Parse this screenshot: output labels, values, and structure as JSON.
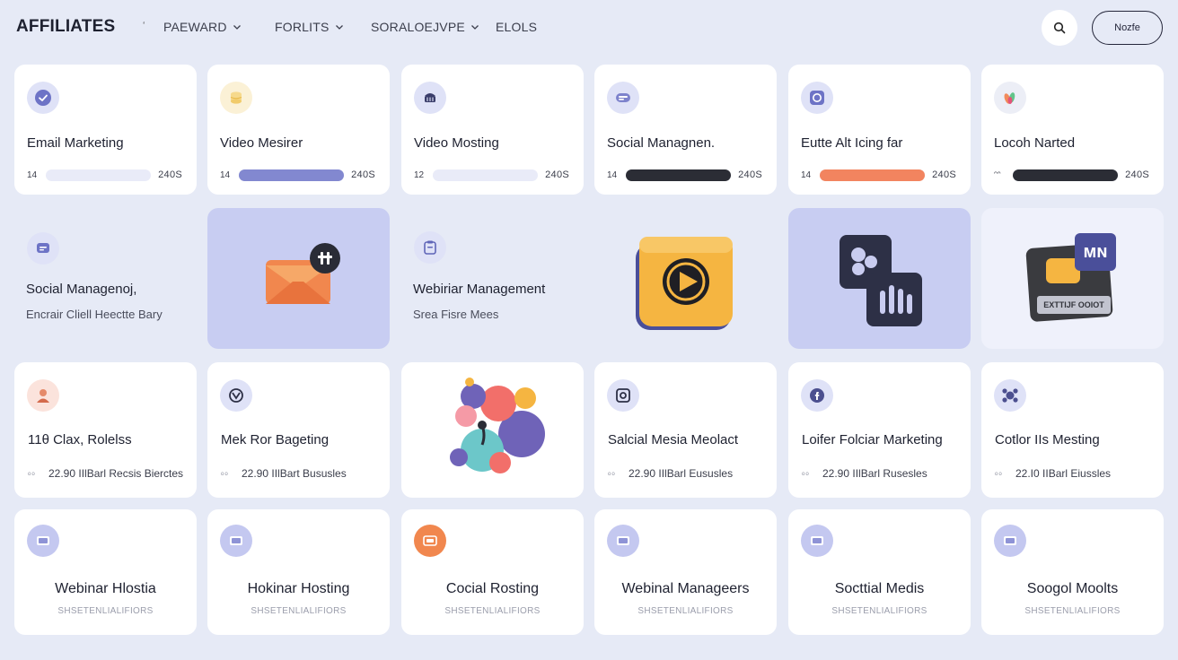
{
  "header": {
    "brand": "AFFILIATES",
    "nav_tick": "ʻ",
    "nav": [
      "PAEWARD",
      "FORLITS",
      "SORALOEJVPE",
      "ELOLS"
    ],
    "cta": "Nozfe"
  },
  "row1": [
    {
      "title": "Email Marketing",
      "left": "14",
      "right": "240S",
      "progress": 0,
      "color": "#e9ebf8"
    },
    {
      "title": "Video Mesirer",
      "left": "14",
      "right": "240S",
      "progress": 1.0,
      "color": "#8288d0"
    },
    {
      "title": "Video Mosting",
      "left": "12",
      "right": "240S",
      "progress": 0,
      "color": "#e9ebf8"
    },
    {
      "title": "Social Managnen.",
      "left": "14",
      "right": "240S",
      "progress": 1.0,
      "color": "#2b2d35"
    },
    {
      "title": "Eutte Alt Icing far",
      "left": "14",
      "right": "240S",
      "progress": 1.0,
      "color": "#f2845f"
    },
    {
      "title": "Locoh Narted",
      "left": "ᵔᵔ",
      "right": "240S",
      "progress": 1.0,
      "color": "#2b2d35"
    }
  ],
  "row2": [
    {
      "title": "Social Managenoj,",
      "sub": "Encrair Cliell Heectte Bary"
    },
    {
      "title": "Webiriar Management",
      "sub": "Srea Fisre Mees"
    }
  ],
  "row2_art": {
    "card6_label_top": "ᴍɴ",
    "card6_label_bottom": "EXTTIJF OOIOT"
  },
  "row3": [
    {
      "title": "11θ Clax, Rolelss",
      "dots": "ᵒᵒ",
      "sub": "22.90 IIlBarl Recsis Bierctes"
    },
    {
      "title": "Mek Ror Bageting",
      "dots": "ᵒᵒ",
      "sub": "22.90 IIlBart Bususles"
    },
    {
      "title": "Salcial Mesia Meolact",
      "dots": "ᵒᵒ",
      "sub": "22.90 IIlBarl Eususles"
    },
    {
      "title": "Loifer Folciar Marketing",
      "dots": "ᵒᵒ",
      "sub": "22.90 IIlBarl Rusesles"
    },
    {
      "title": "Cotlor IIs Mesting",
      "dots": "ᵒᵒ",
      "sub": "22.I0 IIBarl Eiussles"
    }
  ],
  "row4": [
    {
      "title": "Webinar Hlostia",
      "sub": "SHSETENLIALIFIORS"
    },
    {
      "title": "Hokinar Hosting",
      "sub": "SHSETENLIALIFIORS"
    },
    {
      "title": "Cocial Rosting",
      "sub": "SHSETENLIALIFIORS"
    },
    {
      "title": "Webinal Manageers",
      "sub": "SHSETENLIALIFIORS"
    },
    {
      "title": "Socttial Medis",
      "sub": "SHSETENLIALIFIORS"
    },
    {
      "title": "Soogol Moolts",
      "sub": "SHSETENLIALIFIORS"
    }
  ]
}
